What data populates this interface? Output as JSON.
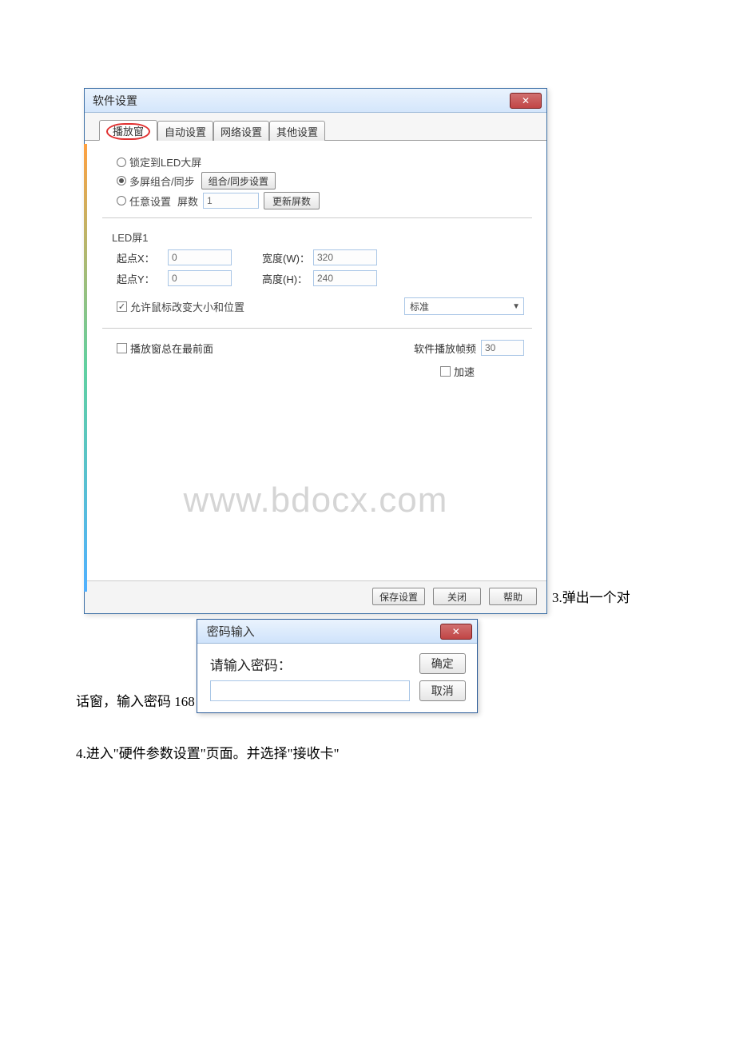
{
  "mainWindow": {
    "title": "软件设置",
    "closeGlyph": "✕",
    "tabs": [
      "播放窗",
      "自动设置",
      "网络设置",
      "其他设置"
    ],
    "opts": {
      "lockToLed": "锁定到LED大屏",
      "multiScreen": "多屏组合/同步",
      "combineBtn": "组合/同步设置",
      "freeSet": "任意设置",
      "screensLabel": "屏数",
      "screensVal": "1",
      "updateBtn": "更新屏数"
    },
    "groupTitle": "LED屏1",
    "xy": {
      "x1Label": "起点X：",
      "x1Val": "0",
      "wLabel": "宽度(W)：",
      "wVal": "320",
      "y1Label": "起点Y：",
      "y1Val": "0",
      "hLabel": "高度(H)：",
      "hVal": "240"
    },
    "allowMouse": "允许鼠标改变大小和位置",
    "comboStandard": "标准",
    "alwaysFront": "播放窗总在最前面",
    "playFpsLabel": "软件播放帧频",
    "playFpsVal": "30",
    "accel": "加速",
    "buttons": {
      "save": "保存设置",
      "close": "关闭",
      "help": "帮助"
    }
  },
  "watermark": "www.bdocx.com",
  "sideText3": "3.弹出一个对",
  "pwLead": "话窗，输入密码 168",
  "pwDialog": {
    "title": "密码输入",
    "closeGlyph": "✕",
    "prompt": "请输入密码：",
    "ok": "确定",
    "cancel": "取消"
  },
  "step4": "4.进入\"硬件参数设置\"页面。并选择\"接收卡\""
}
